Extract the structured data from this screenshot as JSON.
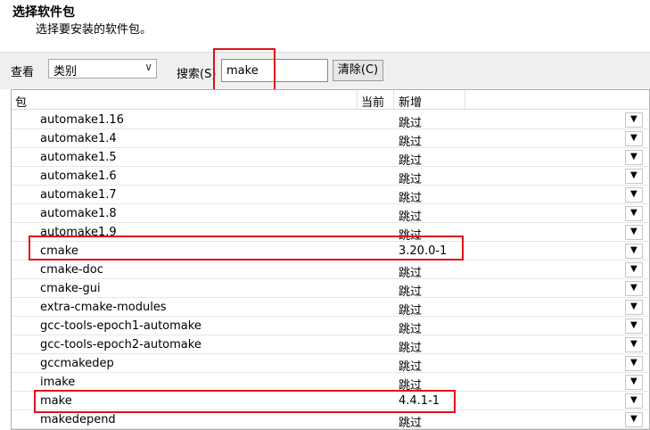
{
  "header": {
    "title": "选择软件包",
    "subtitle": "选择要安装的软件包。"
  },
  "toolbar": {
    "view_label": "查看",
    "view_value": "类别",
    "search_label": "搜索(S)",
    "search_value": "make",
    "clear_label": "清除(C)"
  },
  "table": {
    "columns": [
      "包",
      "当前",
      "新增"
    ],
    "rows": [
      {
        "package": "automake1.16",
        "current": "",
        "new": "跳过"
      },
      {
        "package": "automake1.4",
        "current": "",
        "new": "跳过"
      },
      {
        "package": "automake1.5",
        "current": "",
        "new": "跳过"
      },
      {
        "package": "automake1.6",
        "current": "",
        "new": "跳过"
      },
      {
        "package": "automake1.7",
        "current": "",
        "new": "跳过"
      },
      {
        "package": "automake1.8",
        "current": "",
        "new": "跳过"
      },
      {
        "package": "automake1.9",
        "current": "",
        "new": "跳过"
      },
      {
        "package": "cmake",
        "current": "",
        "new": "3.20.0-1"
      },
      {
        "package": "cmake-doc",
        "current": "",
        "new": "跳过"
      },
      {
        "package": "cmake-gui",
        "current": "",
        "new": "跳过"
      },
      {
        "package": "extra-cmake-modules",
        "current": "",
        "new": "跳过"
      },
      {
        "package": "gcc-tools-epoch1-automake",
        "current": "",
        "new": "跳过"
      },
      {
        "package": "gcc-tools-epoch2-automake",
        "current": "",
        "new": "跳过"
      },
      {
        "package": "gccmakedep",
        "current": "",
        "new": "跳过"
      },
      {
        "package": "imake",
        "current": "",
        "new": "跳过"
      },
      {
        "package": "make",
        "current": "",
        "new": "4.4.1-1"
      },
      {
        "package": "makedepend",
        "current": "",
        "new": "跳过"
      }
    ]
  },
  "icons": {
    "dropdown": "chevron-down-icon",
    "cell_dropdown": "triangle-down-icon"
  },
  "colors": {
    "highlight": "#e0111a",
    "toolbar_bg": "#f0f0f0"
  }
}
